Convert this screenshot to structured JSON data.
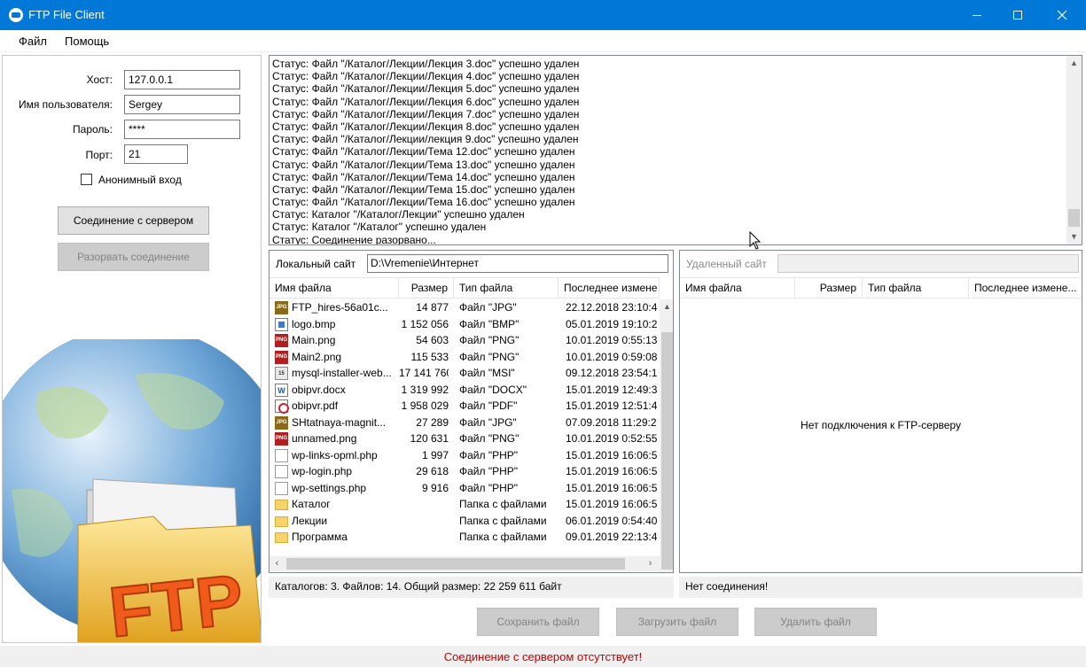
{
  "window": {
    "title": "FTP File Client"
  },
  "menu": {
    "items": [
      "Файл",
      "Помощь"
    ]
  },
  "connection": {
    "host_label": "Хост:",
    "host_value": "127.0.0.1",
    "user_label": "Имя пользователя:",
    "user_value": "Sergey",
    "password_label": "Пароль:",
    "password_value": "****",
    "port_label": "Порт:",
    "port_value": "21",
    "anonymous_label": "Анонимный вход",
    "connect_button": "Соединение с сервером",
    "disconnect_button": "Разорвать соединение"
  },
  "log": [
    "Статус:  Файл \"/Каталог/Лекции/Лекция 3.doc\" успешно удален",
    "Статус:  Файл \"/Каталог/Лекции/Лекция 4.doc\" успешно удален",
    "Статус:  Файл \"/Каталог/Лекции/Лекция 5.doc\" успешно удален",
    "Статус:  Файл \"/Каталог/Лекции/Лекция 6.doc\" успешно удален",
    "Статус:  Файл \"/Каталог/Лекции/Лекция 7.doc\" успешно удален",
    "Статус:  Файл \"/Каталог/Лекции/Лекция 8.doc\" успешно удален",
    "Статус:  Файл \"/Каталог/Лекции/лекция 9.doc\" успешно удален",
    "Статус:  Файл \"/Каталог/Лекции/Тема 12.doc\" успешно удален",
    "Статус:  Файл \"/Каталог/Лекции/Тема 13.doc\" успешно удален",
    "Статус:  Файл \"/Каталог/Лекции/Тема 14.doc\" успешно удален",
    "Статус:  Файл \"/Каталог/Лекции/Тема 15.doc\" успешно удален",
    "Статус:  Файл \"/Каталог/Лекции/Тема 16.doc\" успешно удален",
    "Статус:  Каталог \"/Каталог/Лекции\" успешно удален",
    "Статус:  Каталог \"/Каталог\" успешно удален",
    "Статус:  Соединение разорвано..."
  ],
  "local": {
    "site_label": "Локальный сайт",
    "path": "D:\\Vremenie\\Интернет",
    "columns": [
      "Имя файла",
      "Размер",
      "Тип файла",
      "Последнее измене"
    ],
    "files": [
      {
        "name": "FTP_hires-56a01c...",
        "size": "14 877",
        "type": "Файл \"JPG\"",
        "modified": "22.12.2018 23:10:4",
        "icon": "jpg-icon",
        "icon_text": "JPG"
      },
      {
        "name": "logo.bmp",
        "size": "1 152 056",
        "type": "Файл \"BMP\"",
        "modified": "05.01.2019 19:10:2",
        "icon": "bmp-icon",
        "icon_text": ""
      },
      {
        "name": "Main.png",
        "size": "54 603",
        "type": "Файл \"PNG\"",
        "modified": "10.01.2019 0:55:13",
        "icon": "png-icon",
        "icon_text": "PNG"
      },
      {
        "name": "Main2.png",
        "size": "115 533",
        "type": "Файл \"PNG\"",
        "modified": "10.01.2019 0:59:08",
        "icon": "png-icon",
        "icon_text": "PNG"
      },
      {
        "name": "mysql-installer-web...",
        "size": "17 141 760",
        "type": "Файл \"MSI\"",
        "modified": "09.12.2018 23:54:1",
        "icon": "msi-icon",
        "icon_text": "15"
      },
      {
        "name": "obipvr.docx",
        "size": "1 319 992",
        "type": "Файл \"DOCX\"",
        "modified": "15.01.2019 12:49:3",
        "icon": "docx-icon",
        "icon_text": "W"
      },
      {
        "name": "obipvr.pdf",
        "size": "1 958 029",
        "type": "Файл \"PDF\"",
        "modified": "15.01.2019 12:51:4",
        "icon": "pdf-icon",
        "icon_text": ""
      },
      {
        "name": "SHtatnaya-magnit...",
        "size": "27 289",
        "type": "Файл \"JPG\"",
        "modified": "07.09.2018 11:29:2",
        "icon": "jpg-icon",
        "icon_text": "JPG"
      },
      {
        "name": "unnamed.png",
        "size": "120 631",
        "type": "Файл \"PNG\"",
        "modified": "10.01.2019 0:52:55",
        "icon": "png-icon",
        "icon_text": "PNG"
      },
      {
        "name": "wp-links-opml.php",
        "size": "1 997",
        "type": "Файл \"PHP\"",
        "modified": "15.01.2019 16:06:5",
        "icon": "php-icon",
        "icon_text": ""
      },
      {
        "name": "wp-login.php",
        "size": "29 618",
        "type": "Файл \"PHP\"",
        "modified": "15.01.2019 16:06:5",
        "icon": "php-icon",
        "icon_text": ""
      },
      {
        "name": "wp-settings.php",
        "size": "9 916",
        "type": "Файл \"PHP\"",
        "modified": "15.01.2019 16:06:5",
        "icon": "php-icon",
        "icon_text": ""
      },
      {
        "name": "Каталог",
        "size": "",
        "type": "Папка с файлами",
        "modified": "15.01.2019 16:06:5",
        "icon": "folder-icon",
        "icon_text": ""
      },
      {
        "name": "Лекции",
        "size": "",
        "type": "Папка с файлами",
        "modified": "06.01.2019 0:54:40",
        "icon": "folder-icon",
        "icon_text": ""
      },
      {
        "name": "Программа",
        "size": "",
        "type": "Папка с файлами",
        "modified": "09.01.2019 22:13:4",
        "icon": "folder-icon",
        "icon_text": ""
      }
    ],
    "summary": "Каталогов: 3. Файлов: 14. Общий размер: 22 259 611 байт"
  },
  "remote": {
    "site_label": "Удаленный сайт",
    "path": "",
    "columns": [
      "Имя файла",
      "Размер",
      "Тип файла",
      "Последнее измене..."
    ],
    "empty_message": "Нет подключения к FTP-серверу",
    "summary": "Нет соединения!"
  },
  "actions": {
    "save": "Сохранить файл",
    "upload": "Загрузить файл",
    "delete": "Удалить файл"
  },
  "status_message": "Соединение с сервером отсутствует!",
  "art_text": "FTP",
  "colors": {
    "titlebar": "#0078d7",
    "status_error": "#c00000"
  }
}
